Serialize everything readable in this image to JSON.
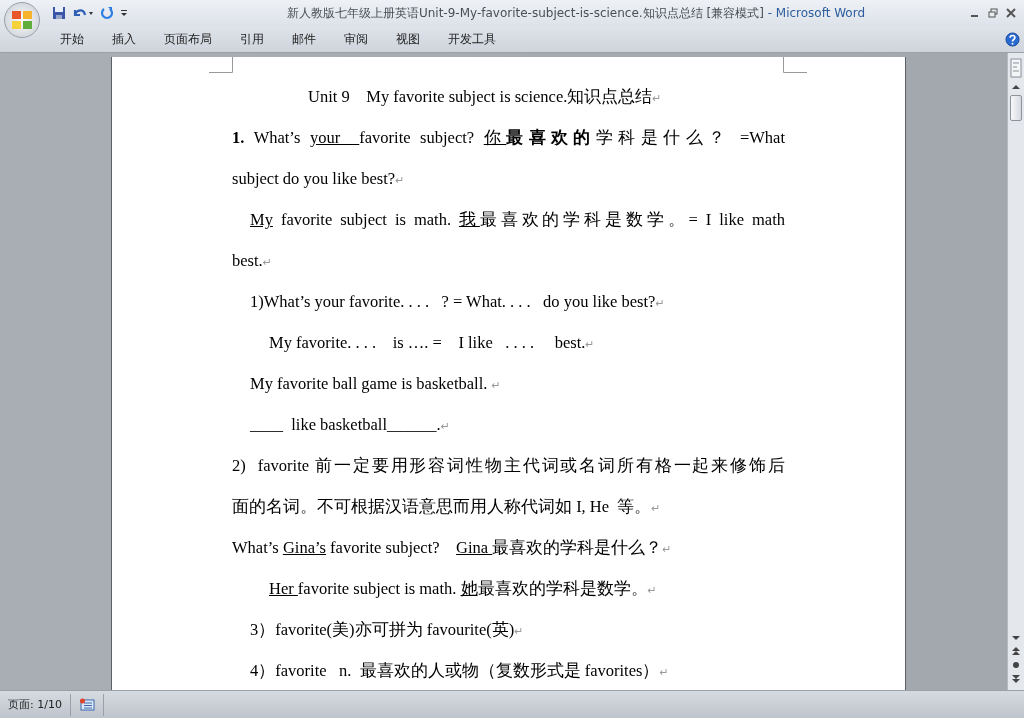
{
  "window": {
    "title": "新人教版七年级上册英语Unit-9-My-favorite-subject-is-science.知识点总结 [兼容模式]",
    "app_name": "- Microsoft Word"
  },
  "ribbon_tabs": [
    {
      "label": "开始",
      "selected": false
    },
    {
      "label": "插入",
      "selected": false
    },
    {
      "label": "页面布局",
      "selected": false
    },
    {
      "label": "引用",
      "selected": false
    },
    {
      "label": "邮件",
      "selected": false
    },
    {
      "label": "审阅",
      "selected": false
    },
    {
      "label": "视图",
      "selected": false
    },
    {
      "label": "开发工具",
      "selected": false
    }
  ],
  "document": {
    "lines": [
      {
        "kind": "title",
        "runs": [
          {
            "kind": "plain",
            "text": "Unit 9    My favorite subject is science.知识点总结"
          },
          {
            "kind": "mark",
            "text": "↵"
          }
        ]
      },
      {
        "kind": "justified",
        "runs": [
          {
            "kind": "bold",
            "text": "1."
          },
          {
            "kind": "plain",
            "text": " What’s "
          },
          {
            "kind": "underline",
            "text": "your  "
          },
          {
            "kind": "plain",
            "text": "favorite subject? "
          },
          {
            "kind": "underline",
            "text": "你"
          },
          {
            "kind": "bold",
            "text": "最喜欢的"
          },
          {
            "kind": "plain",
            "text": "学科是什么？ =What"
          }
        ]
      },
      {
        "kind": "plain",
        "runs": [
          {
            "kind": "plain",
            "text": "subject do you like best?"
          },
          {
            "kind": "mark",
            "text": "↵"
          }
        ]
      },
      {
        "kind": "justified-indent",
        "runs": [
          {
            "kind": "underline",
            "text": "My"
          },
          {
            "kind": "plain",
            "text": " favorite subject is math. "
          },
          {
            "kind": "underline",
            "text": "我"
          },
          {
            "kind": "plain",
            "text": "最喜欢的学科是数学。= I like math"
          }
        ]
      },
      {
        "kind": "plain",
        "runs": [
          {
            "kind": "plain",
            "text": "best."
          },
          {
            "kind": "mark",
            "text": "↵"
          }
        ]
      },
      {
        "kind": "indent",
        "runs": [
          {
            "kind": "plain",
            "text": "1)What’s your favorite. . . .   ? = What. . . .   do you like best?"
          },
          {
            "kind": "mark",
            "text": "↵"
          }
        ]
      },
      {
        "kind": "indent2",
        "runs": [
          {
            "kind": "plain",
            "text": "My favorite. . . .    is …. =    I like   . . . .     best."
          },
          {
            "kind": "mark",
            "text": "↵"
          }
        ]
      },
      {
        "kind": "indent",
        "runs": [
          {
            "kind": "plain",
            "text": "My favorite ball game is basketball. "
          },
          {
            "kind": "mark",
            "text": "↵"
          }
        ]
      },
      {
        "kind": "indent",
        "runs": [
          {
            "kind": "plain",
            "text": "____  like basketball______."
          },
          {
            "kind": "mark",
            "text": "↵"
          }
        ]
      },
      {
        "kind": "justified",
        "runs": [
          {
            "kind": "plain",
            "text": "2)  favorite 前一定要用形容词性物主代词或名词所有格一起来修饰后"
          }
        ]
      },
      {
        "kind": "plain",
        "runs": [
          {
            "kind": "plain",
            "text": "面的名词。不可根据汉语意思而用人称代词如 I, He  等。"
          },
          {
            "kind": "mark",
            "text": "↵"
          }
        ]
      },
      {
        "kind": "plain",
        "runs": [
          {
            "kind": "plain",
            "text": "What’s "
          },
          {
            "kind": "underline",
            "text": "Gina’s"
          },
          {
            "kind": "plain",
            "text": " favorite subject?    "
          },
          {
            "kind": "underline",
            "text": "Gina "
          },
          {
            "kind": "plain",
            "text": "最喜欢的学科是什么？"
          },
          {
            "kind": "mark",
            "text": "↵"
          }
        ]
      },
      {
        "kind": "indent2",
        "runs": [
          {
            "kind": "underline",
            "text": "Her "
          },
          {
            "kind": "plain",
            "text": "favorite subject is math. "
          },
          {
            "kind": "underline",
            "text": "她"
          },
          {
            "kind": "plain",
            "text": "最喜欢的学科是数学。"
          },
          {
            "kind": "mark",
            "text": "↵"
          }
        ]
      },
      {
        "kind": "indent",
        "runs": [
          {
            "kind": "plain",
            "text": "3）favorite(美)亦可拼为 favourite(英)"
          },
          {
            "kind": "mark",
            "text": "↵"
          }
        ]
      },
      {
        "kind": "indent",
        "runs": [
          {
            "kind": "plain",
            "text": "4）favorite   n.  最喜欢的人或物（复数形式是 favorites）"
          },
          {
            "kind": "mark",
            "text": "↵"
          }
        ]
      }
    ]
  },
  "status_bar": {
    "page": "页面: 1/10"
  }
}
